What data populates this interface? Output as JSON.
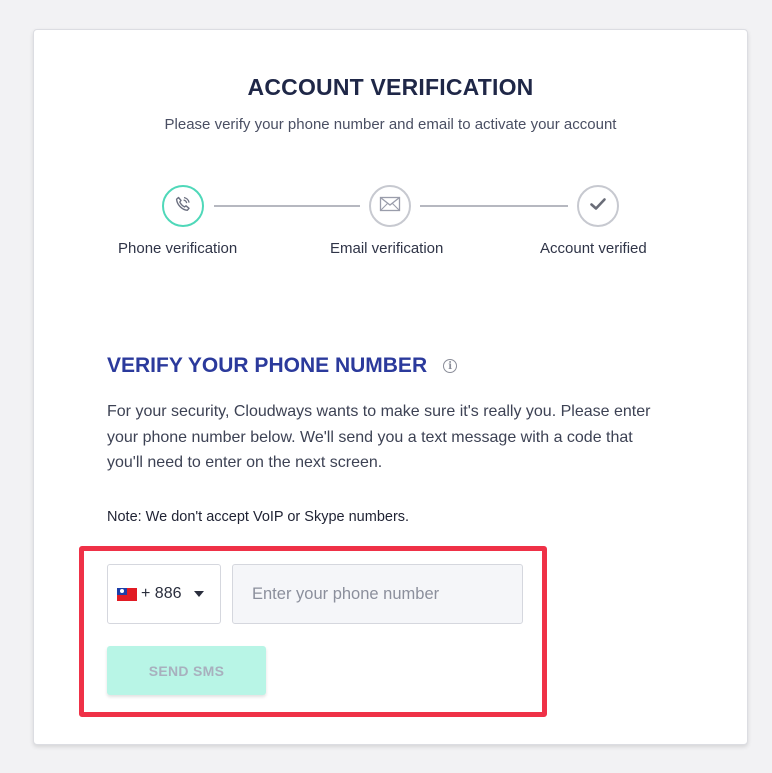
{
  "header": {
    "title": "ACCOUNT VERIFICATION",
    "subtitle": "Please verify your phone number and email to activate your account"
  },
  "steps": [
    {
      "label": "Phone verification",
      "icon": "phone-icon",
      "state": "active"
    },
    {
      "label": "Email verification",
      "icon": "envelope-icon",
      "state": "pending"
    },
    {
      "label": "Account verified",
      "icon": "checkmark-icon",
      "state": "pending"
    }
  ],
  "section": {
    "title": "VERIFY YOUR PHONE NUMBER",
    "info_icon": "info-icon",
    "description": "For your security, Cloudways wants to make sure it's really you. Please enter your phone number below. We'll send you a text message with a code that you'll need to enter on the next screen.",
    "note": "Note: We don't accept VoIP or Skype numbers."
  },
  "form": {
    "country_flag": "taiwan-flag-icon",
    "dial_code": "+ 886",
    "phone_value": "",
    "phone_placeholder": "Enter your phone number",
    "send_button": "SEND SMS"
  },
  "colors": {
    "accent_active": "#4fd8b9",
    "section_title": "#2b3a9c",
    "highlight_border": "#ef3147",
    "button_bg": "#b8f5e6"
  }
}
